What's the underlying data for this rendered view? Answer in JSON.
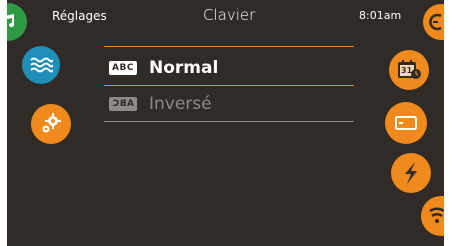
{
  "header": {
    "back_label": "Réglages",
    "title": "Clavier",
    "time": "8:01am"
  },
  "options": [
    {
      "badge": "ABC",
      "label": "Normal",
      "selected": true
    },
    {
      "badge": "ABC",
      "label": "Inversé",
      "selected": false
    }
  ],
  "calendar_day": "31",
  "colors": {
    "background": "#312b27",
    "accent_orange": "#f08a1c",
    "music_green": "#2f9a44",
    "water_blue": "#1d8fb8",
    "muted_text": "#8f8a86"
  },
  "icons": {
    "left": [
      "music-icon",
      "water-icon",
      "settings-gear-icon"
    ],
    "right": [
      "clock-arrow-icon",
      "calendar-clock-icon",
      "keyboard-icon",
      "lightning-icon",
      "wifi-icon"
    ]
  }
}
